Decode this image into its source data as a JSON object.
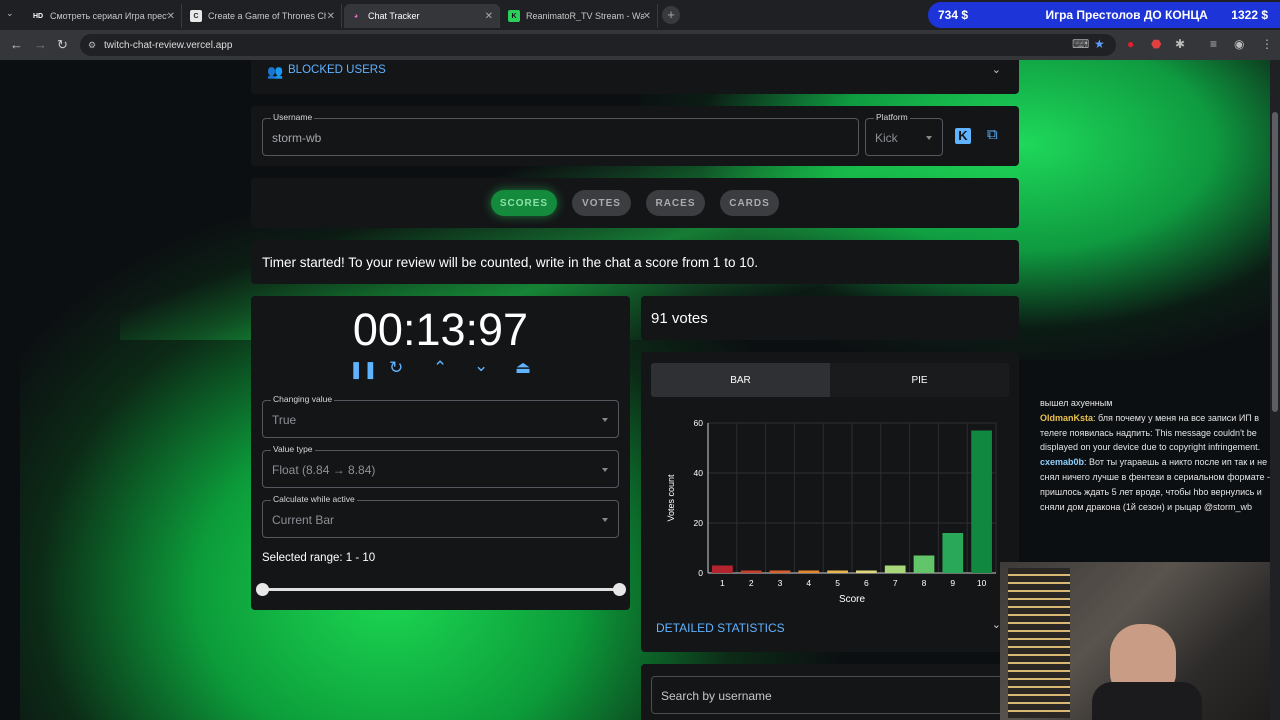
{
  "browser": {
    "tabs": [
      {
        "favicon": "HD",
        "title": "Смотреть сериал Игра престо..."
      },
      {
        "favicon": "C",
        "title": "Create a Game of Thrones Cha..."
      },
      {
        "favicon": "◕",
        "title": "Chat Tracker"
      },
      {
        "favicon": "K",
        "title": "ReanimatoR_TV Stream - Watch..."
      }
    ],
    "url": "twitch-chat-review.vercel.app"
  },
  "banner": {
    "left": "734 $",
    "middle": "Игра Престолов ДО КОНЦА",
    "right": "1322 $"
  },
  "blocked": {
    "label": "BLOCKED USERS"
  },
  "user": {
    "username_label": "Username",
    "username_value": "storm-wb",
    "platform_label": "Platform",
    "platform_value": "Kick"
  },
  "modes": [
    "SCORES",
    "VOTES",
    "RACES",
    "CARDS"
  ],
  "notice": "Timer started! To your review will be counted, write in the chat a score from 1 to 10.",
  "timer": {
    "display": "00:13:97",
    "changing_label": "Changing value",
    "changing_value": "True",
    "type_label": "Value type",
    "type_value": "Float (8.84 → 8.84)",
    "calc_label": "Calculate while active",
    "calc_value": "Current Bar",
    "range_text": "Selected range: 1 - 10"
  },
  "votes": {
    "count_text": "91 votes",
    "toggle_bar": "BAR",
    "toggle_pie": "PIE",
    "detailed": "DETAILED STATISTICS",
    "search_placeholder": "Search by username"
  },
  "chart_data": {
    "type": "bar",
    "categories": [
      "1",
      "2",
      "3",
      "4",
      "5",
      "6",
      "7",
      "8",
      "9",
      "10"
    ],
    "values": [
      3,
      1,
      1,
      1,
      1,
      1,
      3,
      7,
      16,
      57
    ],
    "colors": [
      "#b3242e",
      "#c8402c",
      "#d8602f",
      "#e4892f",
      "#e8b650",
      "#dfd97a",
      "#a8d87a",
      "#62c56a",
      "#2aa85a",
      "#10883f"
    ],
    "xlabel": "Score",
    "ylabel": "Votes count",
    "ylim": [
      0,
      60
    ],
    "yticks": [
      0,
      20,
      40,
      60
    ],
    "grid": true
  },
  "chat": [
    {
      "user": "",
      "text": "вышел ахуенным"
    },
    {
      "user": "OldmanKsta",
      "text": "бля почему у меня на все записи ИП в телеге появилась надпить: This message couldn't be displayed on your device due to copyright infringement."
    },
    {
      "user": "cxemab0b",
      "text": "Вот ты угараешь а никто после ип так и не снял ничего лучше в фентези в сериальном формате - пришлось ждать 5 лет вроде, чтобы hbo вернулись и сняли дом дракона (1й сезон) и рыцар @storm_wb"
    }
  ]
}
